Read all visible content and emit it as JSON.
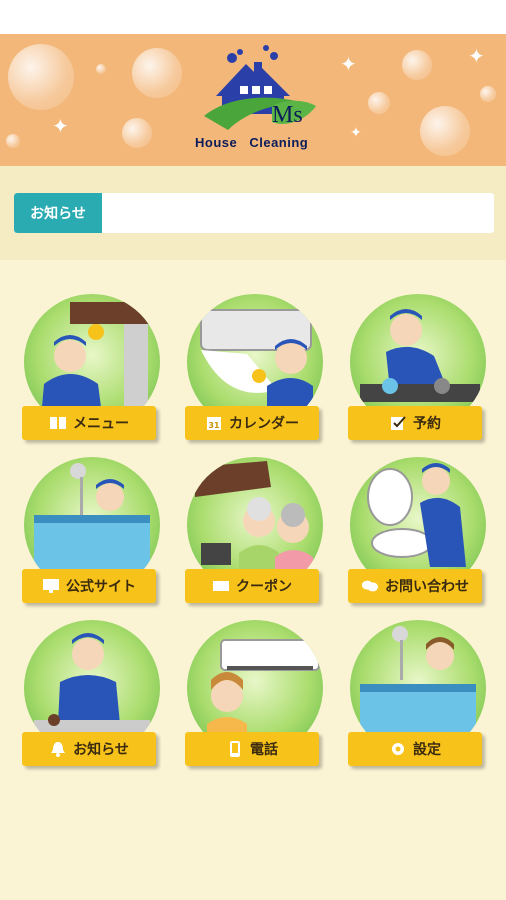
{
  "header": {
    "logo_mark": "Ms",
    "logo_text": "House Cleaning",
    "colors": {
      "banner": "#f3b77a",
      "navy": "#0c1c5a",
      "leaf": "#4aa63a"
    }
  },
  "notice": {
    "label": "お知らせ",
    "text": ""
  },
  "menu": [
    {
      "label": "メニュー",
      "icon": "book-icon"
    },
    {
      "label": "カレンダー",
      "icon": "calendar-icon",
      "icon_text": "31"
    },
    {
      "label": "予約",
      "icon": "checklist-icon"
    },
    {
      "label": "公式サイト",
      "icon": "monitor-icon"
    },
    {
      "label": "クーポン",
      "icon": "ticket-icon"
    },
    {
      "label": "お問い合わせ",
      "icon": "chat-bubbles-icon"
    },
    {
      "label": "お知らせ",
      "icon": "bell-icon"
    },
    {
      "label": "電話",
      "icon": "smartphone-icon"
    },
    {
      "label": "設定",
      "icon": "gear-icon"
    }
  ],
  "colors": {
    "button": "#f7c21a",
    "notice_label": "#2aabb2",
    "background": "#fbf4d4"
  }
}
